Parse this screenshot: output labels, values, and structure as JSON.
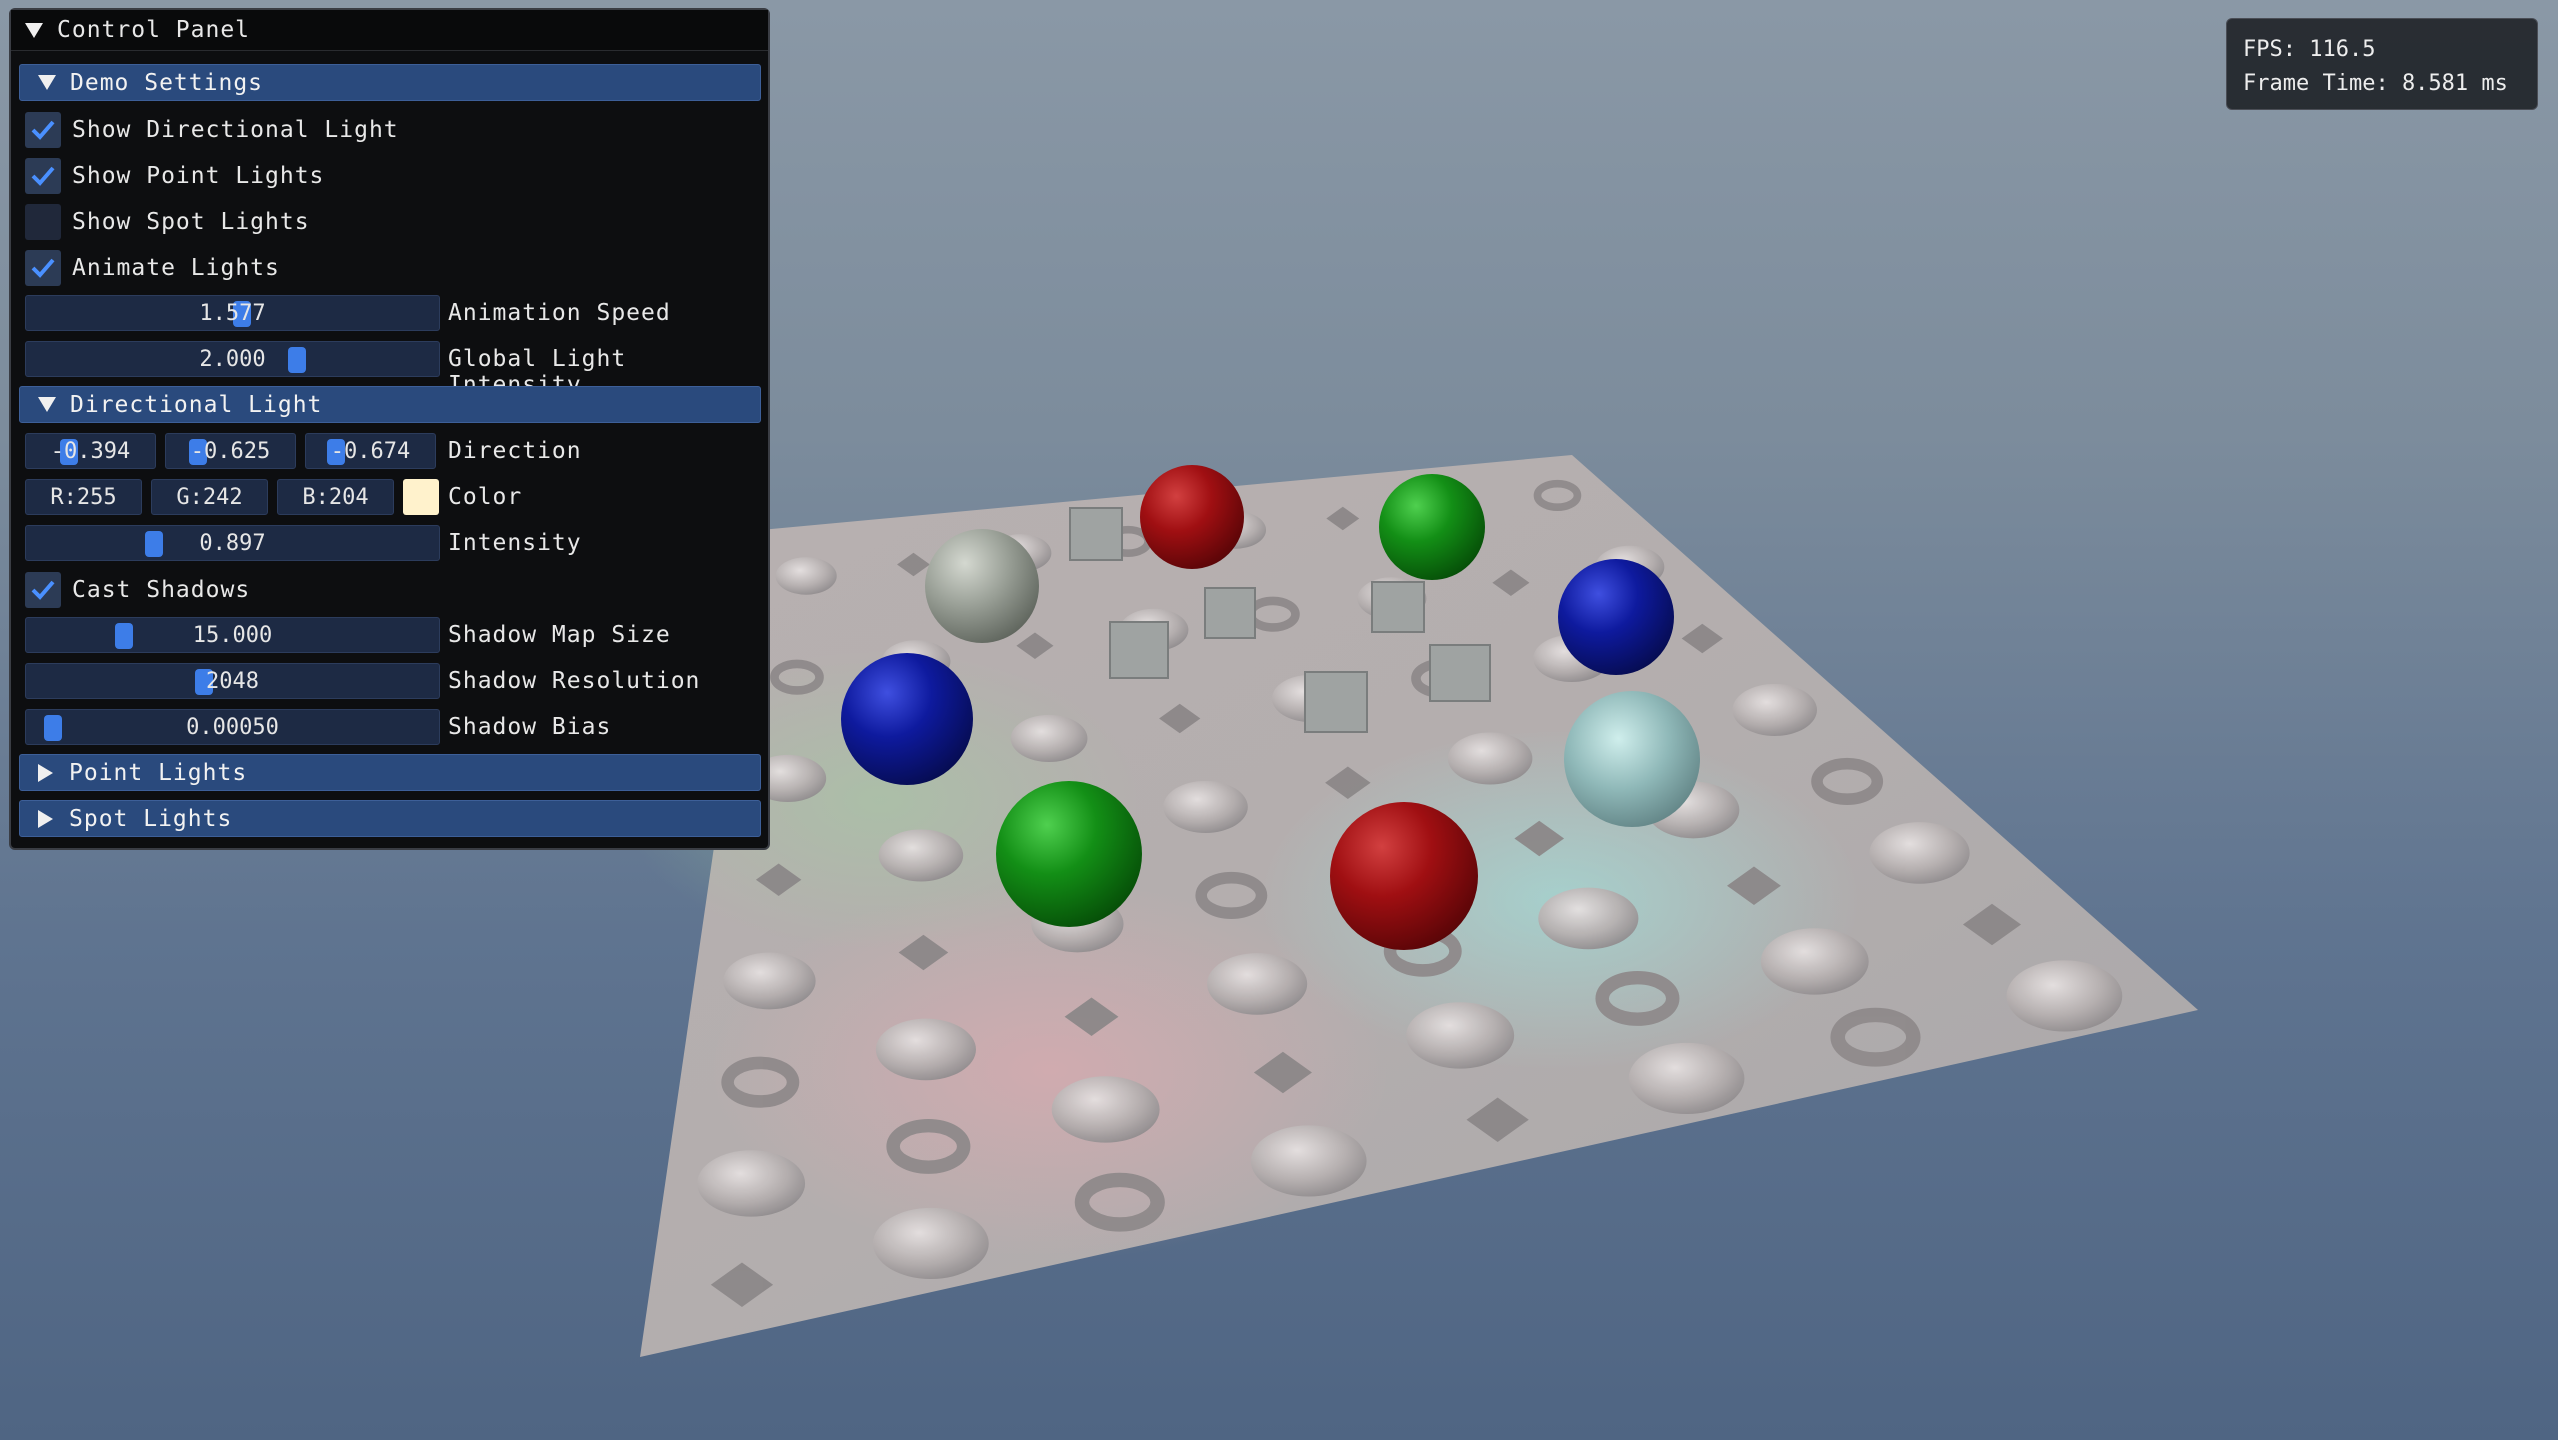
{
  "window": {
    "title": "Control Panel"
  },
  "fps_overlay": {
    "fps": "FPS: 116.5",
    "frame_time": "Frame Time: 8.581 ms"
  },
  "sections": {
    "demo_settings": {
      "title": "Demo Settings",
      "show_directional_light": {
        "label": "Show Directional Light",
        "checked": true
      },
      "show_point_lights": {
        "label": "Show Point Lights",
        "checked": true
      },
      "show_spot_lights": {
        "label": "Show Spot Lights",
        "checked": false
      },
      "animate_lights": {
        "label": "Animate Lights",
        "checked": true
      },
      "animation_speed": {
        "label": "Animation Speed",
        "value": "1.577",
        "fraction": 0.53
      },
      "global_light_intensity": {
        "label": "Global Light Intensity",
        "value": "2.000",
        "fraction": 0.67
      }
    },
    "directional_light": {
      "title": "Directional Light",
      "direction": {
        "label": "Direction",
        "x": "-0.394",
        "y": "-0.625",
        "z": "-0.674"
      },
      "color": {
        "label": "Color",
        "r": "R:255",
        "g": "G:242",
        "b": "B:204",
        "hex": "#fff2cc"
      },
      "intensity": {
        "label": "Intensity",
        "value": "0.897",
        "fraction": 0.31
      },
      "cast_shadows": {
        "label": "Cast Shadows",
        "checked": true
      },
      "shadow_map_size": {
        "label": "Shadow Map Size",
        "value": "15.000",
        "fraction": 0.24
      },
      "shadow_resolution": {
        "label": "Shadow Resolution",
        "value": "2048",
        "fraction": 0.43
      },
      "shadow_bias": {
        "label": "Shadow Bias",
        "value": "0.00050",
        "fraction": 0.05
      }
    },
    "point_lights": {
      "title": "Point Lights",
      "expanded": false
    },
    "spot_lights": {
      "title": "Spot Lights",
      "expanded": false
    }
  },
  "colors": {
    "accent": "#3d7de8",
    "header_bg": "#2a4a7d",
    "panel_bg": "#0d0e10"
  }
}
